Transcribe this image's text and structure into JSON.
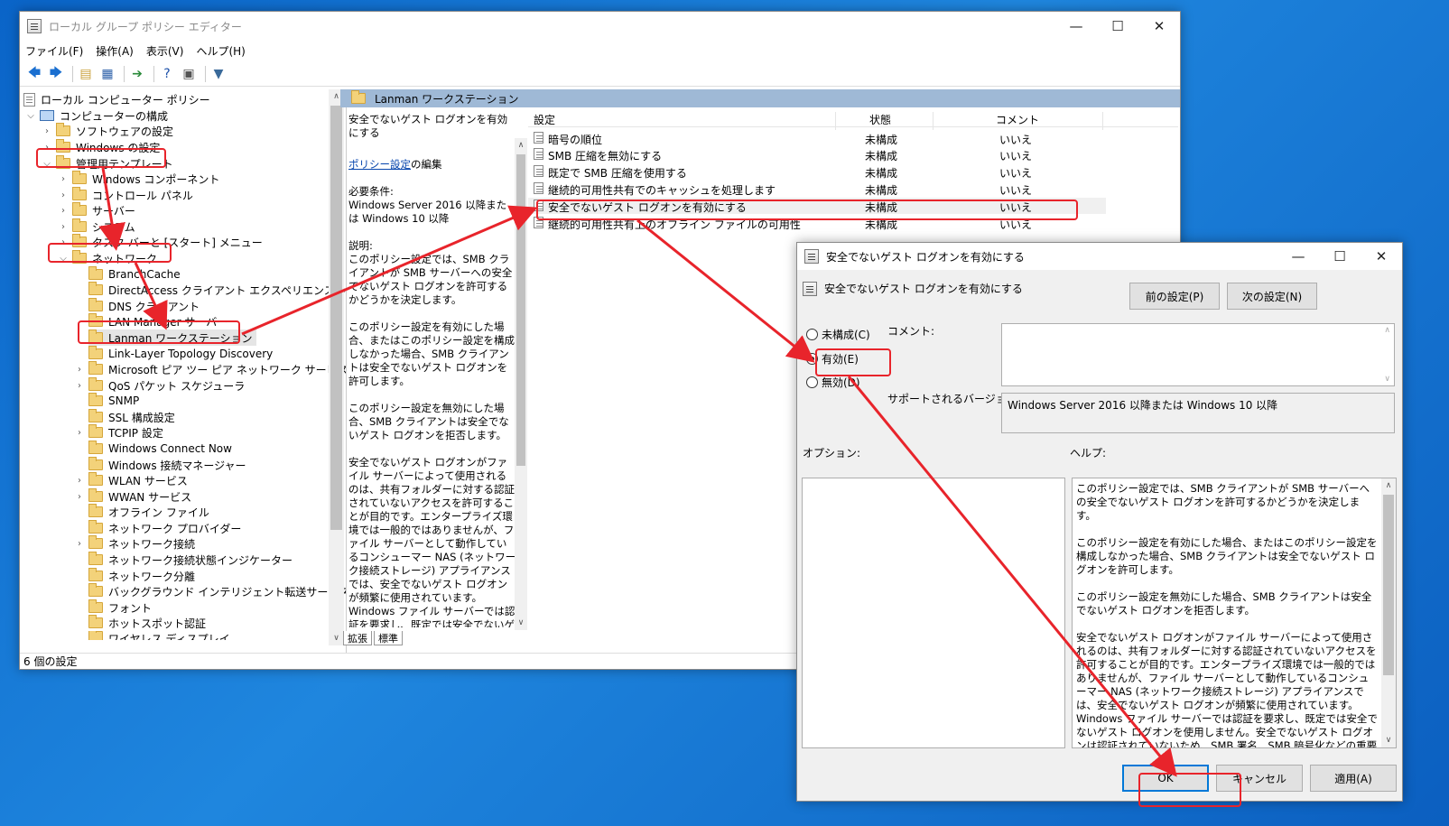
{
  "main_window": {
    "title": "ローカル グループ ポリシー エディター",
    "menu": [
      "ファイル(F)",
      "操作(A)",
      "表示(V)",
      "ヘルプ(H)"
    ],
    "status": "6 個の設定"
  },
  "tree": {
    "items": [
      "ローカル コンピューター ポリシー",
      "コンピューターの構成",
      "ソフトウェアの設定",
      "Windows の設定",
      "管理用テンプレート",
      "Windows コンポーネント",
      "コントロール パネル",
      "サーバー",
      "システム",
      "タスク バーと [スタート] メニュー",
      "ネットワーク",
      "BranchCache",
      "DirectAccess クライアント エクスペリエンスの設定",
      "DNS クライアント",
      "LAN Manager サーバー",
      "Lanman ワークステーション",
      "Link-Layer Topology Discovery",
      "Microsoft ピア ツー ピア ネットワーク サービス",
      "QoS パケット スケジューラ",
      "SNMP",
      "SSL 構成設定",
      "TCPIP 設定",
      "Windows Connect Now",
      "Windows 接続マネージャー",
      "WLAN サービス",
      "WWAN サービス",
      "オフライン ファイル",
      "ネットワーク プロバイダー",
      "ネットワーク接続",
      "ネットワーク接続状態インジケーター",
      "ネットワーク分離",
      "バックグラウンド インテリジェント転送サービス (BITS)",
      "フォント",
      "ホットスポット認証",
      "ワイヤレス ディスプレイ"
    ]
  },
  "header": {
    "title": "Lanman ワークステーション"
  },
  "description": {
    "title": "安全でないゲスト ログオンを有効にする",
    "edit_link": "ポリシー設定",
    "edit_suffix": "の編集",
    "req_label": "必要条件:",
    "req_text": "Windows Server 2016 以降または Windows 10 以降",
    "exp_label": "説明:",
    "p1": "このポリシー設定では、SMB クライアントが SMB サーバーへの安全でないゲスト ログオンを許可するかどうかを決定します。",
    "p2": "このポリシー設定を有効にした場合、またはこのポリシー設定を構成しなかった場合、SMB クライアントは安全でないゲスト ログオンを許可します。",
    "p3": "このポリシー設定を無効にした場合、SMB クライアントは安全でないゲスト ログオンを拒否します。",
    "p4": "安全でないゲスト ログオンがファイル サーバーによって使用されるのは、共有フォルダーに対する認証されていないアクセスを許可することが目的です。エンタープライズ環境では一般的ではありませんが、ファイル サーバーとして動作しているコンシューマー NAS (ネットワーク接続ストレージ) アプライアンスでは、安全でないゲスト ログオンが頻繁に使用されています。Windows ファイル サーバーでは認証を要求し、既定では安全でないゲスト ログオンを使用しません。安全でないゲスト ログオンは認証されていないため、SMB 署名、SMB 暗号化などの重要なセキュリティ機能が無効になります。結"
  },
  "tabs": [
    "拡張",
    "標準"
  ],
  "list": {
    "columns": [
      "設定",
      "状態",
      "コメント"
    ],
    "rows": [
      {
        "name": "暗号の順位",
        "state": "未構成",
        "comment": "いいえ"
      },
      {
        "name": "SMB 圧縮を無効にする",
        "state": "未構成",
        "comment": "いいえ"
      },
      {
        "name": "既定で SMB 圧縮を使用する",
        "state": "未構成",
        "comment": "いいえ"
      },
      {
        "name": "継続的可用性共有でのキャッシュを処理します",
        "state": "未構成",
        "comment": "いいえ"
      },
      {
        "name": "安全でないゲスト ログオンを有効にする",
        "state": "未構成",
        "comment": "いいえ"
      },
      {
        "name": "継続的可用性共有上のオフライン ファイルの可用性",
        "state": "未構成",
        "comment": "いいえ"
      }
    ]
  },
  "dialog": {
    "title": "安全でないゲスト ログオンを有効にする",
    "subtitle": "安全でないゲスト ログオンを有効にする",
    "prev": "前の設定(P)",
    "next": "次の設定(N)",
    "radio_unconfigured": "未構成(C)",
    "radio_enabled": "有効(E)",
    "radio_disabled": "無効(D)",
    "comment_label": "コメント:",
    "supported_label": "サポートされるバージョン:",
    "supported_value": "Windows Server 2016 以降または Windows 10 以降",
    "options_label": "オプション:",
    "help_label": "ヘルプ:",
    "help_p1": "このポリシー設定では、SMB クライアントが SMB サーバーへの安全でないゲスト ログオンを許可するかどうかを決定します。",
    "help_p2": "このポリシー設定を有効にした場合、またはこのポリシー設定を構成しなかった場合、SMB クライアントは安全でないゲスト ログオンを許可します。",
    "help_p3": "このポリシー設定を無効にした場合、SMB クライアントは安全でないゲスト ログオンを拒否します。",
    "help_p4": "安全でないゲスト ログオンがファイル サーバーによって使用されるのは、共有フォルダーに対する認証されていないアクセスを許可することが目的です。エンタープライズ環境では一般的ではありませんが、ファイル サーバーとして動作しているコンシューマー NAS (ネットワーク接続ストレージ) アプライアンスでは、安全でないゲスト ログオンが頻繁に使用されています。Windows ファイル サーバーでは認証を要求し、既定では安全でないゲスト ログオンを使用しません。安全でないゲスト ログオンは認証されていないため、SMB 署名、SMB 暗号化などの重要なセキュリティ機能が無効になります。結果として、安全でないゲスト ログオンを許可するクライアントは、さまざまな man-in-the-middle 攻撃に対して脆弱になり、データ損失、データの破損、マルウェアに対するリスクにつながる可能性があります。また、安全でないゲスト ログオンを使用してファイル サーバーに書き込まれ",
    "ok": "OK",
    "cancel": "キャンセル",
    "apply": "適用(A)"
  },
  "colors": {
    "highlight_red": "#e8242b",
    "desktop_blue": "#1f86de"
  }
}
